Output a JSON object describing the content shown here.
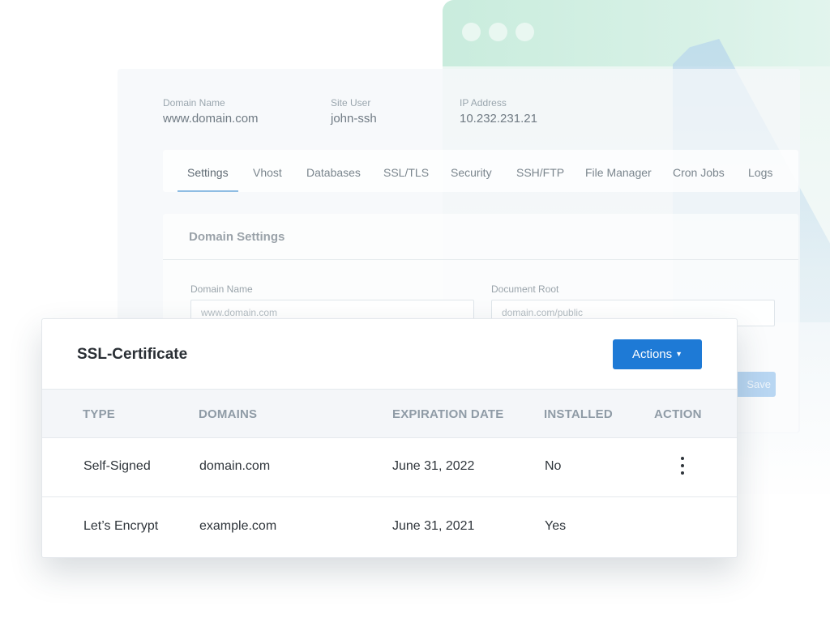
{
  "panel": {
    "meta": [
      {
        "label": "Domain Name",
        "value": "www.domain.com"
      },
      {
        "label": "Site User",
        "value": "john-ssh"
      },
      {
        "label": "IP Address",
        "value": "10.232.231.21"
      }
    ],
    "tabs": [
      "Settings",
      "Vhost",
      "Databases",
      "SSL/TLS",
      "Security",
      "SSH/FTP",
      "File Manager",
      "Cron Jobs",
      "Logs"
    ],
    "active_tab": "Settings",
    "domain_settings": {
      "title": "Domain Settings",
      "domain_name_label": "Domain Name",
      "domain_name_placeholder": "www.domain.com",
      "document_root_label": "Document Root",
      "document_root_placeholder": "domain.com/public",
      "save_label": "Save"
    }
  },
  "ssl": {
    "title": "SSL-Certificate",
    "actions_label": "Actions",
    "actions_icon": "caret-down-icon",
    "columns": [
      "TYPE",
      "DOMAINS",
      "EXPIRATION DATE",
      "INSTALLED",
      "ACTION"
    ],
    "rows": [
      {
        "type": "Self-Signed",
        "domain": "domain.com",
        "expiration": "June 31, 2022",
        "installed": "No",
        "action_icon": "kebab-menu-icon"
      },
      {
        "type": "Let’s Encrypt",
        "domain": "example.com",
        "expiration": "June 31, 2021",
        "installed": "Yes"
      }
    ]
  },
  "colors": {
    "accent": "#1e7ad6",
    "browser_bar": "#c9ecdd",
    "header_bg": "#f4f6f9"
  }
}
